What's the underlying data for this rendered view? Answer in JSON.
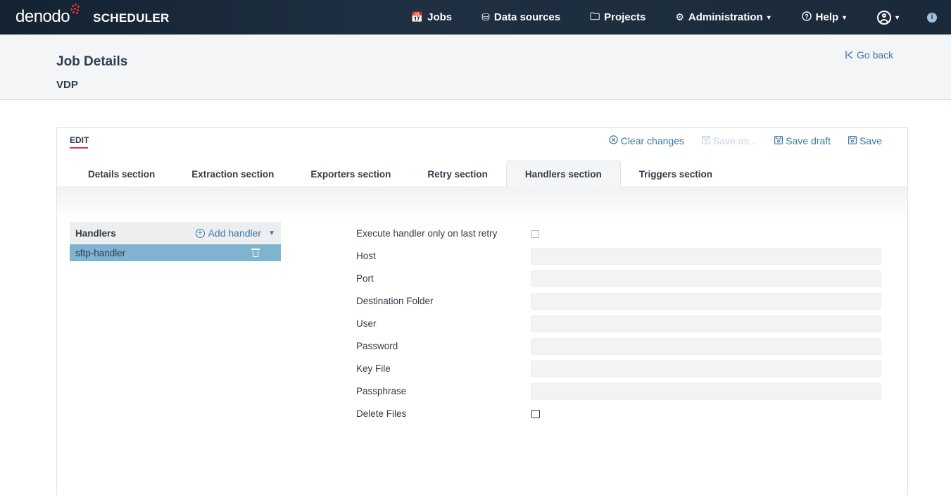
{
  "brand": {
    "logo": "denodo",
    "product": "SCHEDULER"
  },
  "nav": {
    "items": [
      {
        "label": "Jobs",
        "icon": "calendar-icon",
        "glyph": "📅",
        "caret": false
      },
      {
        "label": "Data sources",
        "icon": "database-icon",
        "glyph": "⛁",
        "caret": false
      },
      {
        "label": "Projects",
        "icon": "folder-icon",
        "glyph": "🗀",
        "caret": false
      },
      {
        "label": "Administration",
        "icon": "gear-icon",
        "glyph": "⚙",
        "caret": true
      },
      {
        "label": "Help",
        "icon": "help-icon",
        "glyph": "ⓘ",
        "caret": true
      }
    ],
    "info_glyph": "i"
  },
  "header": {
    "title": "Job Details",
    "subtitle": "VDP",
    "go_back": "Go back"
  },
  "card": {
    "mode_label": "EDIT",
    "actions": [
      {
        "label": "Clear changes",
        "icon": "clear-icon",
        "glyph": "⊗",
        "disabled": false
      },
      {
        "label": "Save as...",
        "icon": "save-as-icon",
        "glyph": "🖫",
        "disabled": true
      },
      {
        "label": "Save draft",
        "icon": "save-draft-icon",
        "glyph": "🖫",
        "disabled": false
      },
      {
        "label": "Save",
        "icon": "save-icon",
        "glyph": "🖫",
        "disabled": false
      }
    ],
    "tabs": [
      {
        "label": "Details section",
        "active": false
      },
      {
        "label": "Extraction section",
        "active": false
      },
      {
        "label": "Exporters section",
        "active": false
      },
      {
        "label": "Retry section",
        "active": false
      },
      {
        "label": "Handlers section",
        "active": true
      },
      {
        "label": "Triggers section",
        "active": false
      }
    ]
  },
  "handlers": {
    "title": "Handlers",
    "add_label": "Add handler",
    "items": [
      {
        "name": "sftp-handler"
      }
    ]
  },
  "form": {
    "fields": [
      {
        "label": "Execute handler only on last retry",
        "type": "checkbox",
        "checked": false
      },
      {
        "label": "Host",
        "type": "text",
        "value": ""
      },
      {
        "label": "Port",
        "type": "text",
        "value": ""
      },
      {
        "label": "Destination Folder",
        "type": "text",
        "value": ""
      },
      {
        "label": "User",
        "type": "text",
        "value": ""
      },
      {
        "label": "Password",
        "type": "text",
        "value": ""
      },
      {
        "label": "Key File",
        "type": "text",
        "value": ""
      },
      {
        "label": "Passphrase",
        "type": "text",
        "value": ""
      },
      {
        "label": "Delete Files",
        "type": "checkbox-dark",
        "checked": false
      }
    ]
  },
  "colors": {
    "nav_bg": "#1b2a3a",
    "accent": "#3a77a8",
    "brand_red": "#e8323c",
    "selected_row": "#7fb3d0"
  }
}
